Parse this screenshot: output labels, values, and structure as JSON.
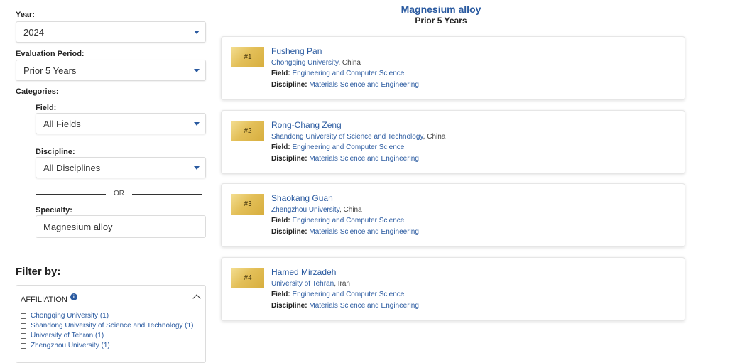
{
  "sidebar": {
    "year": {
      "label": "Year:",
      "value": "2024"
    },
    "period": {
      "label": "Evaluation Period:",
      "value": "Prior 5 Years"
    },
    "categories_label": "Categories:",
    "field": {
      "label": "Field:",
      "value": "All Fields"
    },
    "discipline": {
      "label": "Discipline:",
      "value": "All Disciplines"
    },
    "or_text": "OR",
    "specialty": {
      "label": "Specialty:",
      "value": "Magnesium alloy"
    },
    "filter_title": "Filter by:",
    "affiliation": {
      "title": "AFFILIATION",
      "info_icon": "info-icon",
      "items": [
        {
          "label": "Chongqing University (1)"
        },
        {
          "label": "Shandong University of Science and Technology (1)"
        },
        {
          "label": "University of Tehran (1)"
        },
        {
          "label": "Zhengzhou University (1)"
        }
      ]
    }
  },
  "header": {
    "title": "Magnesium alloy",
    "subtitle": "Prior 5 Years"
  },
  "labels": {
    "field": "Field:",
    "discipline": "Discipline:"
  },
  "results": [
    {
      "rank": "#1",
      "name": "Fusheng Pan",
      "institution": "Chongqing University",
      "country": ", China",
      "field": "Engineering and Computer Science",
      "discipline": "Materials Science and Engineering"
    },
    {
      "rank": "#2",
      "name": "Rong-Chang Zeng",
      "institution": "Shandong University of Science and Technology",
      "country": ", China",
      "field": "Engineering and Computer Science",
      "discipline": "Materials Science and Engineering"
    },
    {
      "rank": "#3",
      "name": "Shaokang Guan",
      "institution": "Zhengzhou University",
      "country": ", China",
      "field": "Engineering and Computer Science",
      "discipline": "Materials Science and Engineering"
    },
    {
      "rank": "#4",
      "name": "Hamed Mirzadeh",
      "institution": "University of Tehran",
      "country": ", Iran",
      "field": "Engineering and Computer Science",
      "discipline": "Materials Science and Engineering"
    }
  ],
  "colors": {
    "link": "#2a5aa0",
    "gold": "#e3bf58"
  }
}
